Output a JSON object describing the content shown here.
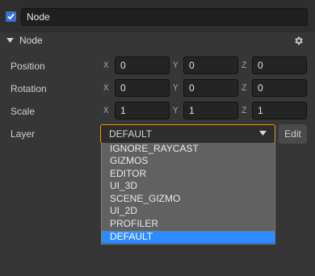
{
  "node": {
    "active": true,
    "name": "Node"
  },
  "section": {
    "title": "Node",
    "collapse_icon": "triangle-down-icon",
    "settings_icon": "gear-icon"
  },
  "transform": {
    "position": {
      "label": "Position",
      "x": "0",
      "y": "0",
      "z": "0"
    },
    "rotation": {
      "label": "Rotation",
      "x": "0",
      "y": "0",
      "z": "0"
    },
    "scale": {
      "label": "Scale",
      "x": "1",
      "y": "1",
      "z": "1"
    },
    "axis_labels": {
      "x": "X",
      "y": "Y",
      "z": "Z"
    }
  },
  "layer": {
    "label": "Layer",
    "selected": "DEFAULT",
    "edit_label": "Edit",
    "options": [
      "IGNORE_RAYCAST",
      "GIZMOS",
      "EDITOR",
      "UI_3D",
      "SCENE_GIZMO",
      "UI_2D",
      "PROFILER",
      "DEFAULT"
    ]
  },
  "colors": {
    "accent": "#3a6fe0",
    "focus_border": "#d49a2e",
    "selected_option": "#2e8bff"
  }
}
